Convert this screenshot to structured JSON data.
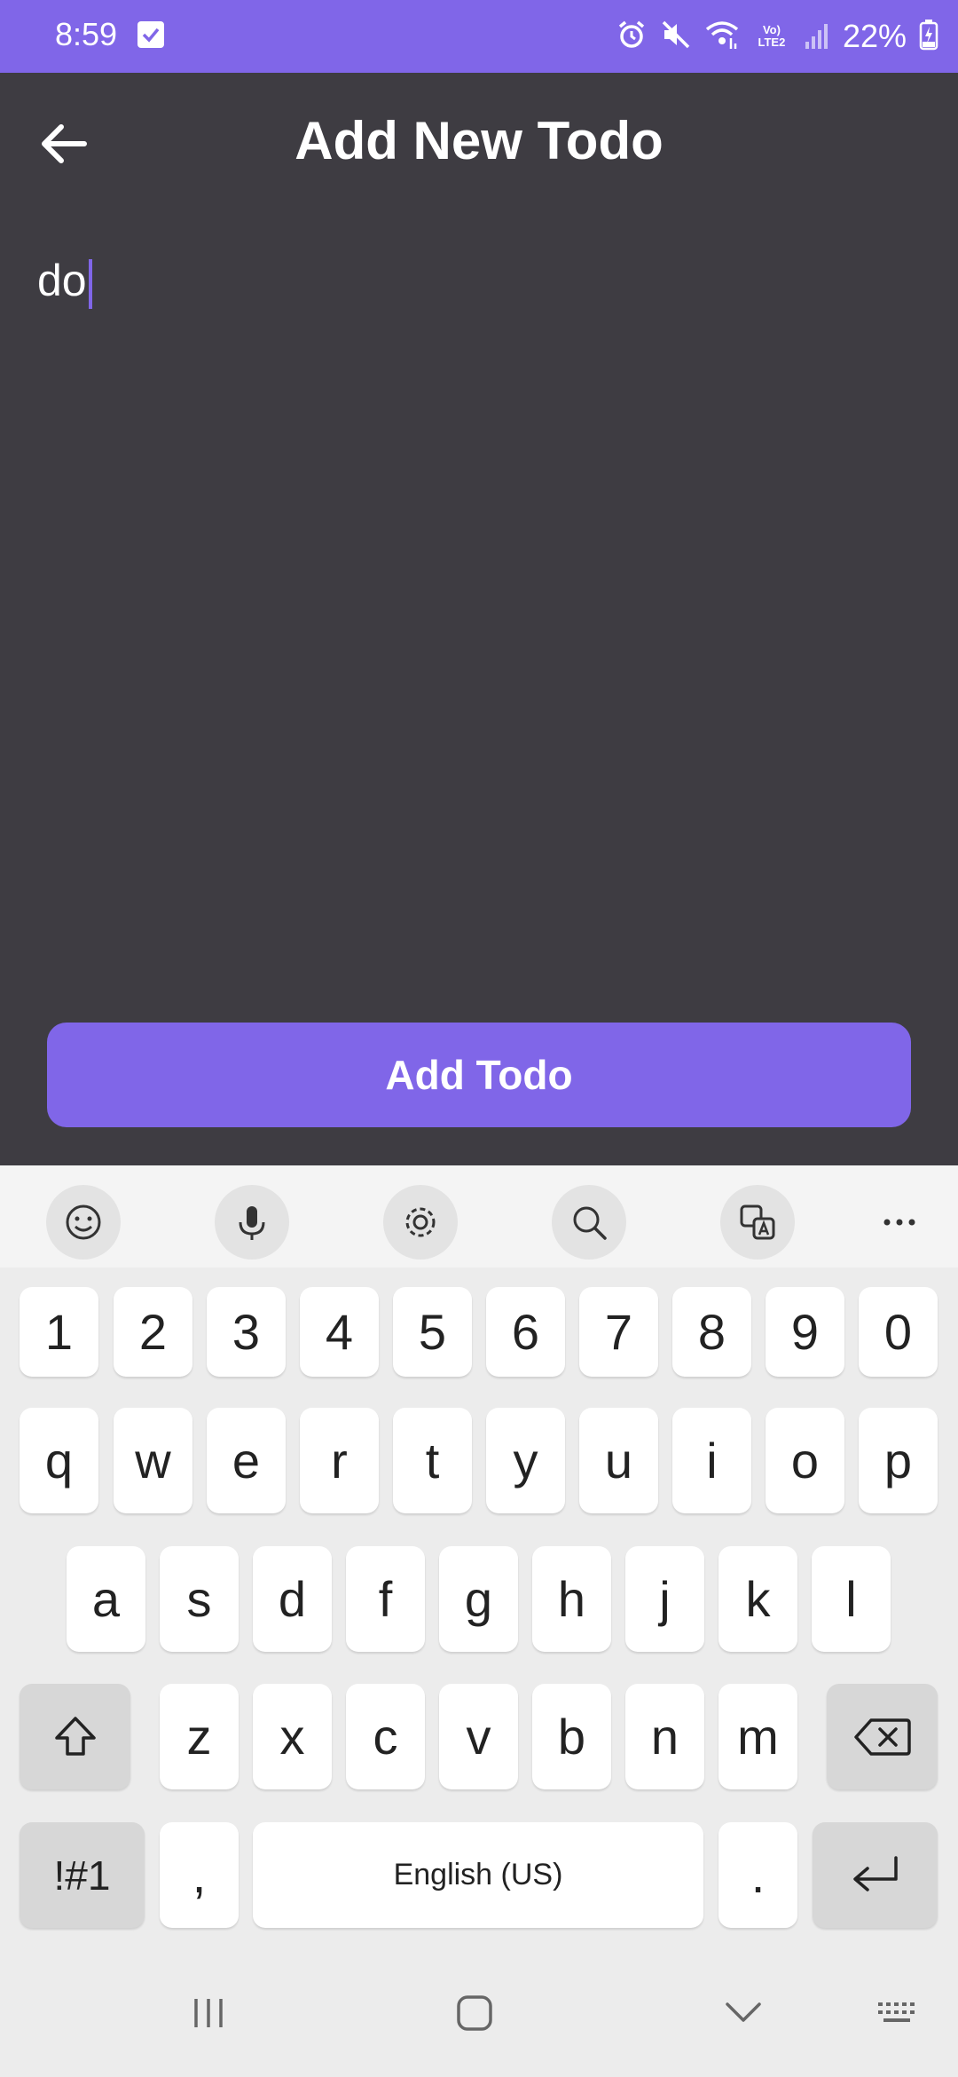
{
  "status_bar": {
    "time": "8:59",
    "network_label": "Vo) LTE2",
    "battery_percent": "22%",
    "icons": [
      "checkbox-notification-icon",
      "alarm-icon",
      "mute-icon",
      "wifi-icon",
      "volte-lte-icon",
      "signal-icon",
      "battery-charging-icon"
    ]
  },
  "app_bar": {
    "back_icon": "arrow-left-icon",
    "title": "Add New Todo"
  },
  "form": {
    "todo_value": "do",
    "submit_label": "Add Todo"
  },
  "keyboard": {
    "toolbar": [
      "emoji-icon",
      "microphone-icon",
      "settings-icon",
      "search-icon",
      "translate-icon",
      "more-icon"
    ],
    "number_row": [
      "1",
      "2",
      "3",
      "4",
      "5",
      "6",
      "7",
      "8",
      "9",
      "0"
    ],
    "row1": [
      "q",
      "w",
      "e",
      "r",
      "t",
      "y",
      "u",
      "i",
      "o",
      "p"
    ],
    "row2": [
      "a",
      "s",
      "d",
      "f",
      "g",
      "h",
      "j",
      "k",
      "l"
    ],
    "row3": [
      "z",
      "x",
      "c",
      "v",
      "b",
      "n",
      "m"
    ],
    "symbols_label": "!#1",
    "comma": ",",
    "space_label": "English (US)",
    "period": ".",
    "special_icons": [
      "shift-icon",
      "backspace-icon",
      "enter-icon"
    ]
  },
  "nav_bar": {
    "icons": [
      "recents-icon",
      "home-icon",
      "back-chevron-icon",
      "keyboard-icon"
    ]
  },
  "colors": {
    "accent": "#8066e8",
    "background": "#3e3c42",
    "keyboard_bg": "#ececec"
  }
}
